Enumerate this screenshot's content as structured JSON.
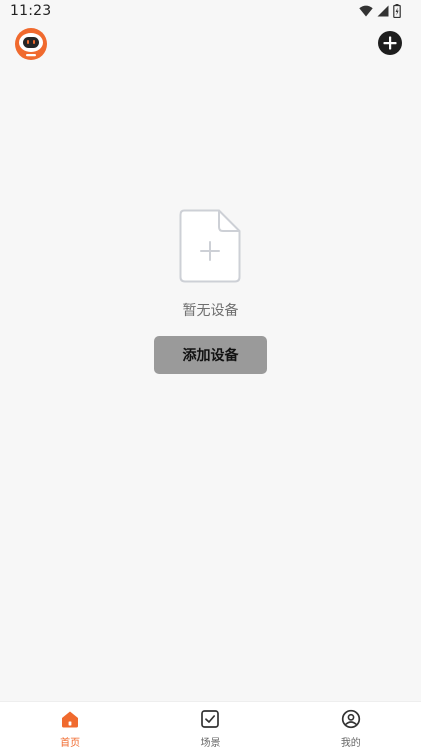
{
  "status_bar": {
    "time": "11:23"
  },
  "app_bar": {
    "logo_icon": "robot-avatar-icon",
    "action_icon": "plus-icon"
  },
  "empty_state": {
    "icon": "file-add-icon",
    "message": "暂无设备",
    "button_label": "添加设备"
  },
  "bottom_nav": {
    "items": [
      {
        "label": "首页",
        "icon": "home-icon",
        "active": true
      },
      {
        "label": "场景",
        "icon": "checkbox-icon",
        "active": false
      },
      {
        "label": "我的",
        "icon": "user-circle-icon",
        "active": false
      }
    ]
  },
  "colors": {
    "accent": "#f06a2e",
    "background": "#f7f7f7",
    "button": "#9a9a9a"
  }
}
